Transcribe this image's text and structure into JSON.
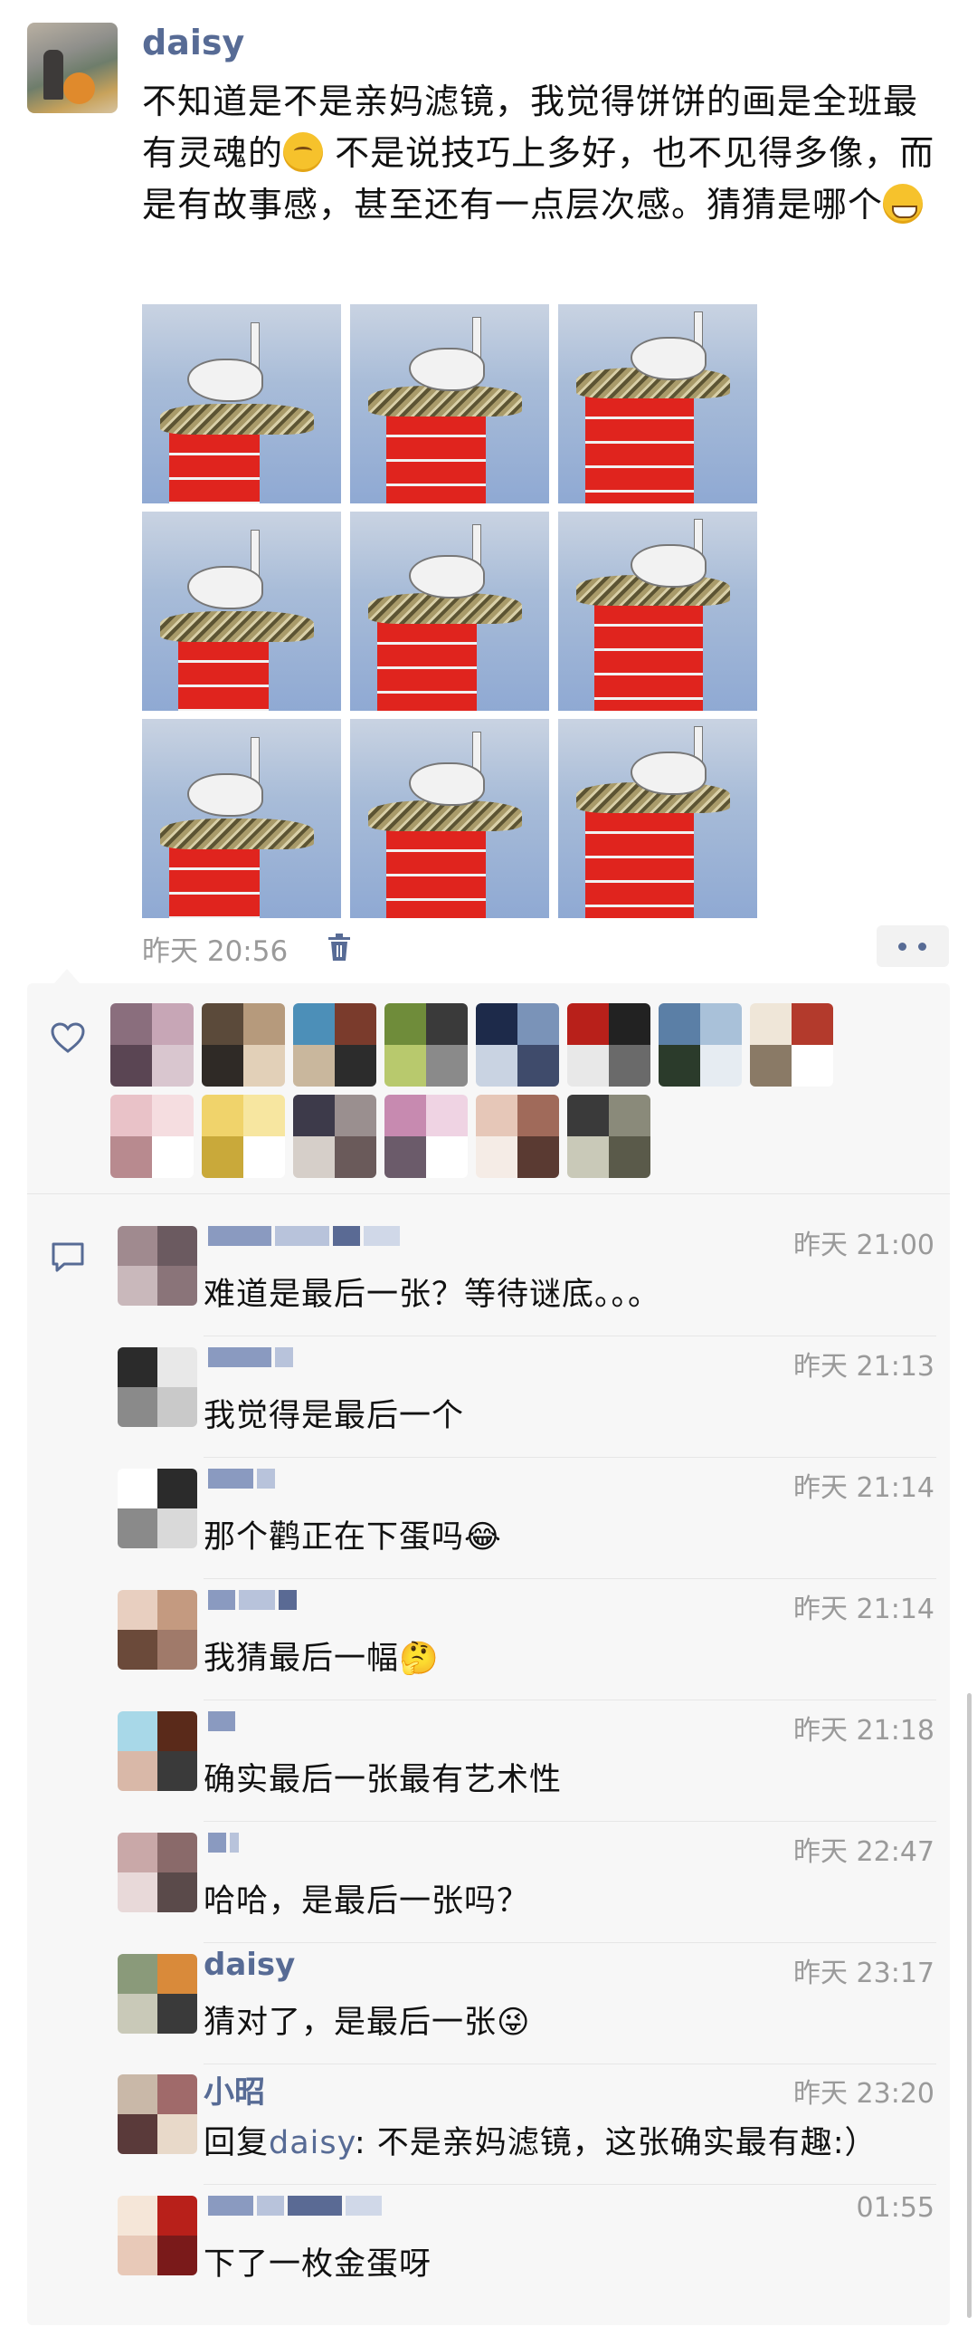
{
  "post": {
    "author": "daisy",
    "text_part1": "不知道是不是亲妈滤镜，我觉得饼饼的画是全班最有灵魂的",
    "text_part2": " 不是说技巧上多好，也不见得多像，而是有故事感，甚至还有一点层次感。猜猜是哪个",
    "time": "昨天 20:56",
    "image_count": 9
  },
  "icons": {
    "like": "heart-icon",
    "comment": "comment-icon",
    "delete": "trash-icon",
    "more": "more-dots-icon"
  },
  "colors": {
    "name_blue": "#576b95",
    "panel": "#f7f7f7",
    "time_gray": "#9a9a9a"
  },
  "comments": [
    {
      "name": "",
      "time": "昨天 21:00",
      "text": "难道是最后一张？等待谜底。。。"
    },
    {
      "name": "",
      "time": "昨天 21:13",
      "text": "我觉得是最后一个"
    },
    {
      "name": "",
      "time": "昨天 21:14",
      "text": "那个鹳正在下蛋吗😂"
    },
    {
      "name": "",
      "time": "昨天 21:14",
      "text": "我猜最后一幅🤔"
    },
    {
      "name": "",
      "time": "昨天 21:18",
      "text": "确实最后一张最有艺术性"
    },
    {
      "name": "",
      "time": "昨天 22:47",
      "text": "哈哈，是最后一张吗？"
    },
    {
      "name": "daisy",
      "time": "昨天 23:17",
      "text": "猜对了，是最后一张😜"
    },
    {
      "name": "小昭",
      "time": "昨天 23:20",
      "reply_prefix": "回复",
      "reply_to": "daisy",
      "text": ": 不是亲妈滤镜，这张确实最有趣:）"
    },
    {
      "name": "",
      "time": "01:55",
      "text": "下了一枚金蛋呀"
    }
  ]
}
